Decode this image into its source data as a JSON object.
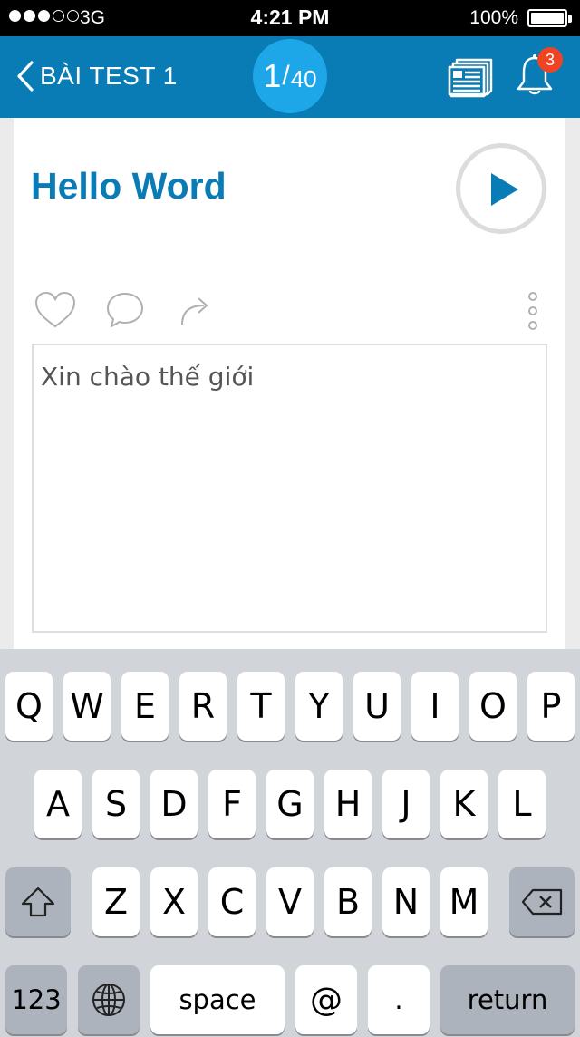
{
  "status_bar": {
    "carrier": "3G",
    "time": "4:21 PM",
    "battery": "100%"
  },
  "nav": {
    "back_label": "BÀI TEST 1",
    "counter_current": "1",
    "counter_separator": "/",
    "counter_total": "40",
    "notification_count": "3"
  },
  "card": {
    "title": "Hello Word",
    "answer_text": "Xin chào thế giới"
  },
  "colors": {
    "nav_blue": "#0a7cb5",
    "counter_blue": "#1da6e8",
    "badge_red": "#ee4424"
  },
  "icons": {
    "back": "chevron-left-icon",
    "news": "newspaper-icon",
    "bell": "bell-icon",
    "play": "play-icon",
    "like": "heart-icon",
    "comment": "comment-icon",
    "share": "share-icon",
    "more": "more-vertical-icon"
  },
  "keyboard": {
    "row1": [
      "Q",
      "W",
      "E",
      "R",
      "T",
      "Y",
      "U",
      "I",
      "O",
      "P"
    ],
    "row2": [
      "A",
      "S",
      "D",
      "F",
      "G",
      "H",
      "J",
      "K",
      "L"
    ],
    "row3": [
      "Z",
      "X",
      "C",
      "V",
      "B",
      "N",
      "M"
    ],
    "numbers": "123",
    "space": "space",
    "at": "@",
    "period": ".",
    "return": "return"
  }
}
